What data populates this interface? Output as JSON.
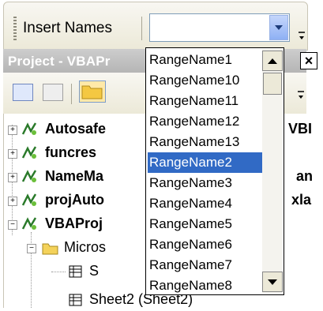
{
  "toolbar": {
    "label": "Insert Names",
    "combo_value": ""
  },
  "project": {
    "title": "Project - VBAPr"
  },
  "tree": {
    "rows": [
      {
        "label": "Autosafe",
        "trail": "VBI"
      },
      {
        "label": "funcres",
        "trail": ""
      },
      {
        "label": "NameMa",
        "trail": "an"
      },
      {
        "label": "projAuto",
        "trail": "xla"
      },
      {
        "label": "VBAProj",
        "trail": ""
      },
      {
        "label": "Micros",
        "trail": ""
      },
      {
        "label": "S",
        "trail": ""
      },
      {
        "label": "Sheet2 (Sheet2)",
        "trail": ""
      }
    ]
  },
  "dropdown": {
    "items": [
      "RangeName1",
      "RangeName10",
      "RangeName11",
      "RangeName12",
      "RangeName13",
      "RangeName2",
      "RangeName3",
      "RangeName4",
      "RangeName5",
      "RangeName6",
      "RangeName7",
      "RangeName8"
    ],
    "selected_index": 5
  },
  "icons": {
    "close": "×",
    "expand": "+",
    "collapse": "−"
  },
  "colors": {
    "selection": "#316ac5",
    "title_bar": "#b5b5b5"
  }
}
